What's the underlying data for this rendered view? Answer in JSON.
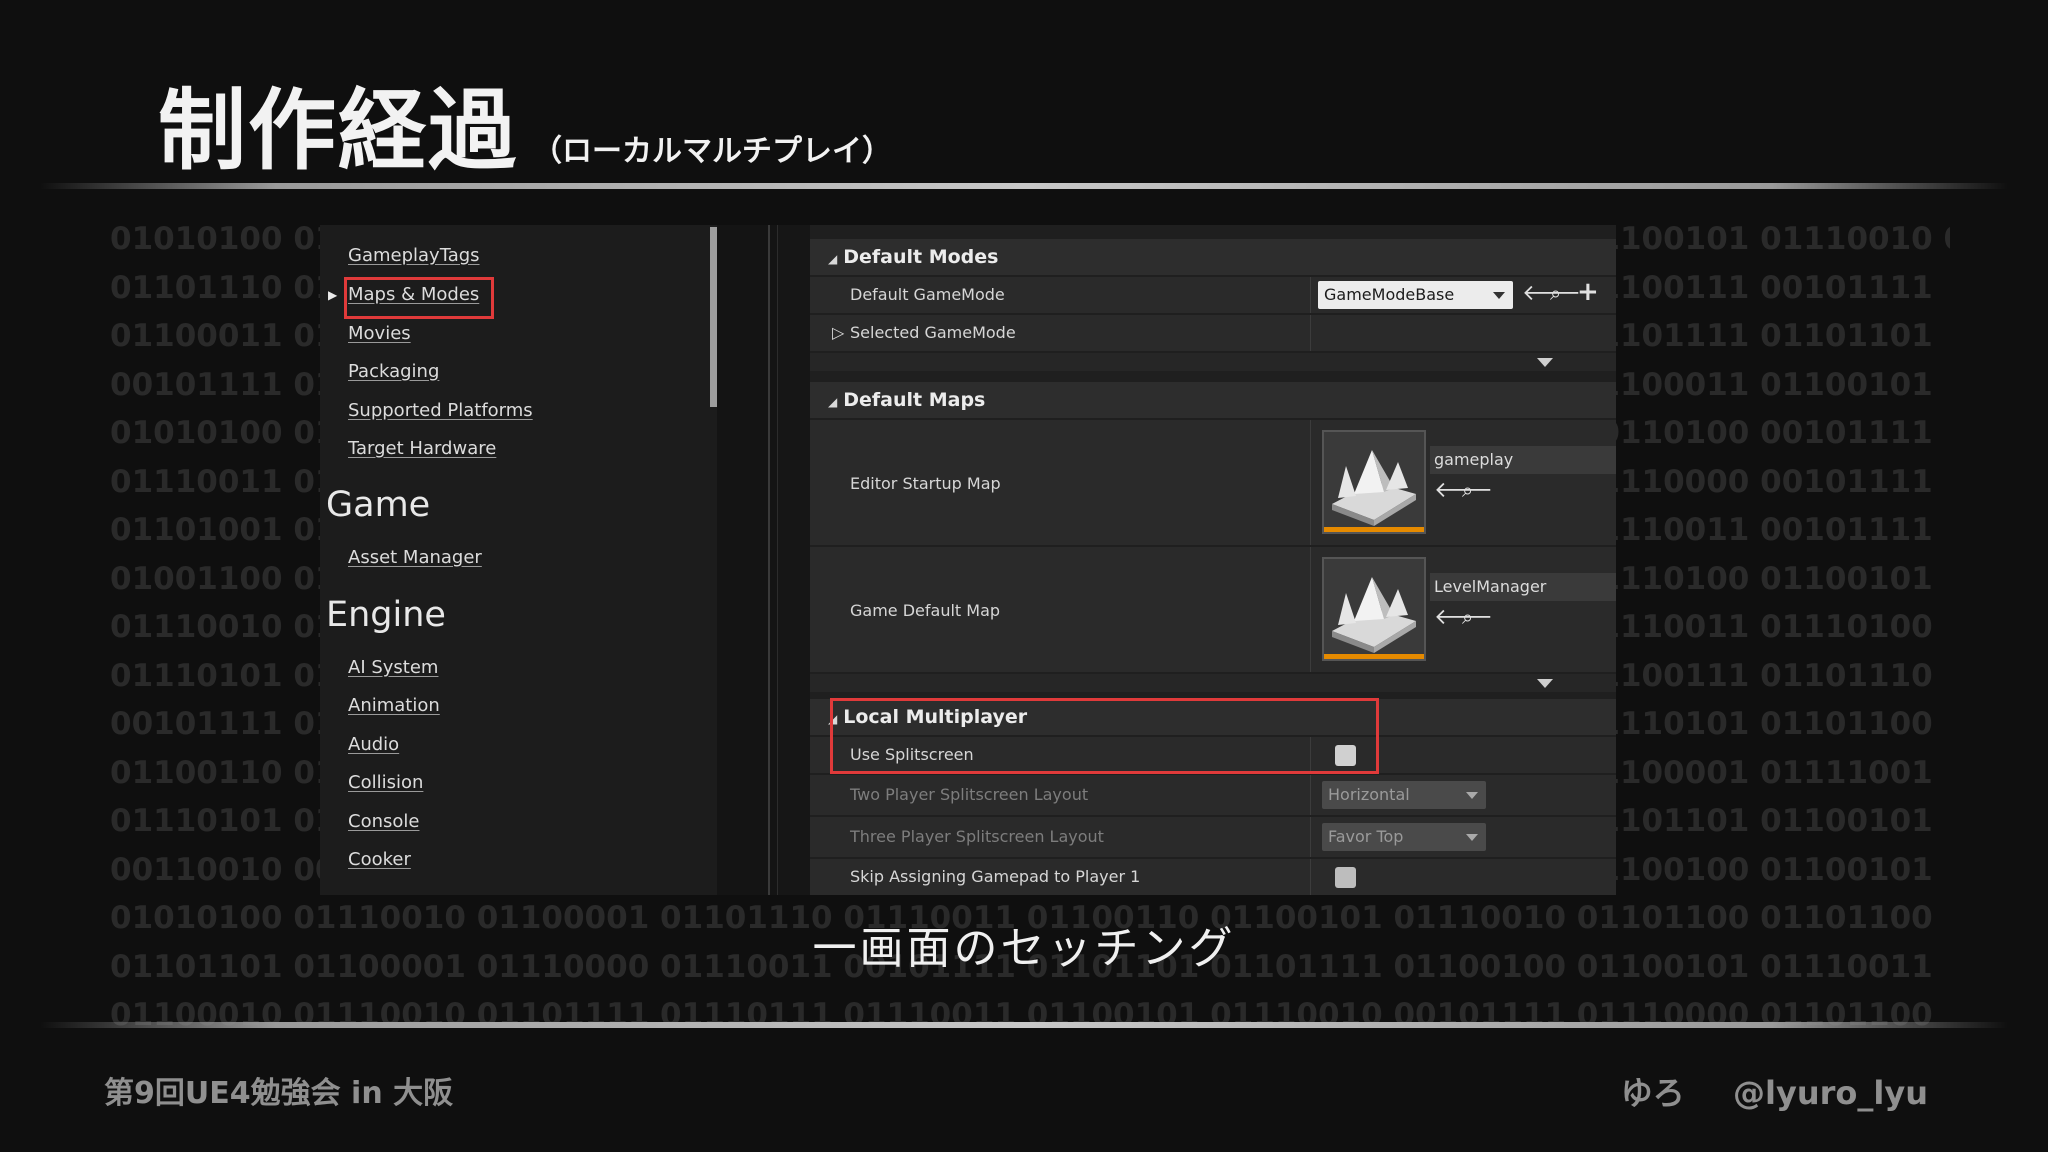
{
  "slide": {
    "title": "制作経過",
    "subtitle": "（ローカルマルチプレイ）",
    "caption": "一画面のセッチング",
    "footer_left": "第9回UE4勉強会 in 大阪",
    "footer_right_name": "ゆろ",
    "footer_right_handle": "@lyuro_lyu"
  },
  "background_binary": [
    "01010100 01110010 01100001 01101110 01110011 01100101 01110010 01100110 01100101 01110010 01100010 01101001",
    "01101110 01110011 01110100 01100001 01101110 01100011 01100101 00101111 01100111 00101111",
    "01100011 01101111 01101110 01110100 01100101 01101110 01110100 00101111 01101111 01101101",
    "00101111 01010100 01110010 01100001 01101110 01110011 01100101 01110010 01100011 01100101",
    "01010100 01110010 01100001 01101110 01110011 01100110 01100101 01110010 00110100 00101111",
    "01110011 01100101 01110010 01110110 01101001 01100011 01100101 00101111 01110000 00101111",
    "01101001 01101110 01110011 01110100 01100001 01101110 01100011 01100101 01110011 00101111",
    "01001100 01101111 01100011 01100001 01101100 01001101 01110101 01101100 01110100 01100101",
    "01110010 01100101 01110011 01101111 01110101 01110010 01100011 01100101 01110011 01110100",
    "01110101 01101110 01110010 01100101 01100001 01101100 01100101 01101110 01100111 01101110",
    "00101111 01101100 01101111 01100011 01100001 01101100 00101111 01101101 01110101 01101100",
    "01100110 01101001 01101100 01100101 01110011 00101111 01110000 01101100 01100001 01111001",
    "01110101 01100101 01110011 01110100 01110011 00101111 01100111 01100001 01101101 01100101",
    "00110010 00110000 00110001 00111000 00101111 01110011 01101100 01101001 01100100 01100101",
    "01010100 01110010 01100001 01101110 01110011 01100110 01100101 01110010 01101100 01101100",
    "01101101 01100001 01110000 01110011 00101111 01101101 01101111 01100100 01100101 01110011",
    "01100010 01110010 01101111 01110111 01110011 01100101 01110010 00101111 01110000 01101100"
  ],
  "nav": {
    "items_top": [
      "GameplayTags",
      "Maps & Modes",
      "Movies",
      "Packaging",
      "Supported Platforms",
      "Target Hardware"
    ],
    "category_game": "Game",
    "items_game": [
      "Asset Manager"
    ],
    "category_engine": "Engine",
    "items_engine": [
      "AI System",
      "Animation",
      "Audio",
      "Collision",
      "Console",
      "Cooker"
    ]
  },
  "details": {
    "default_modes": {
      "header": "Default Modes",
      "gamemode_label": "Default GameMode",
      "gamemode_value": "GameModeBase",
      "selected_gamemode_label": "Selected GameMode"
    },
    "default_maps": {
      "header": "Default Maps",
      "editor_startup_label": "Editor Startup Map",
      "editor_startup_value": "gameplay",
      "game_default_label": "Game Default Map",
      "game_default_value": "LevelManager"
    },
    "local_multiplayer": {
      "header": "Local Multiplayer",
      "use_splitscreen_label": "Use Splitscreen",
      "two_player_label": "Two Player Splitscreen Layout",
      "two_player_value": "Horizontal",
      "three_player_label": "Three Player Splitscreen Layout",
      "three_player_value": "Favor Top",
      "skip_gamepad_label": "Skip Assigning Gamepad to Player 1"
    }
  },
  "colors": {
    "highlight": "#e03a3a",
    "map_thumb_bar": "#e58a00"
  }
}
